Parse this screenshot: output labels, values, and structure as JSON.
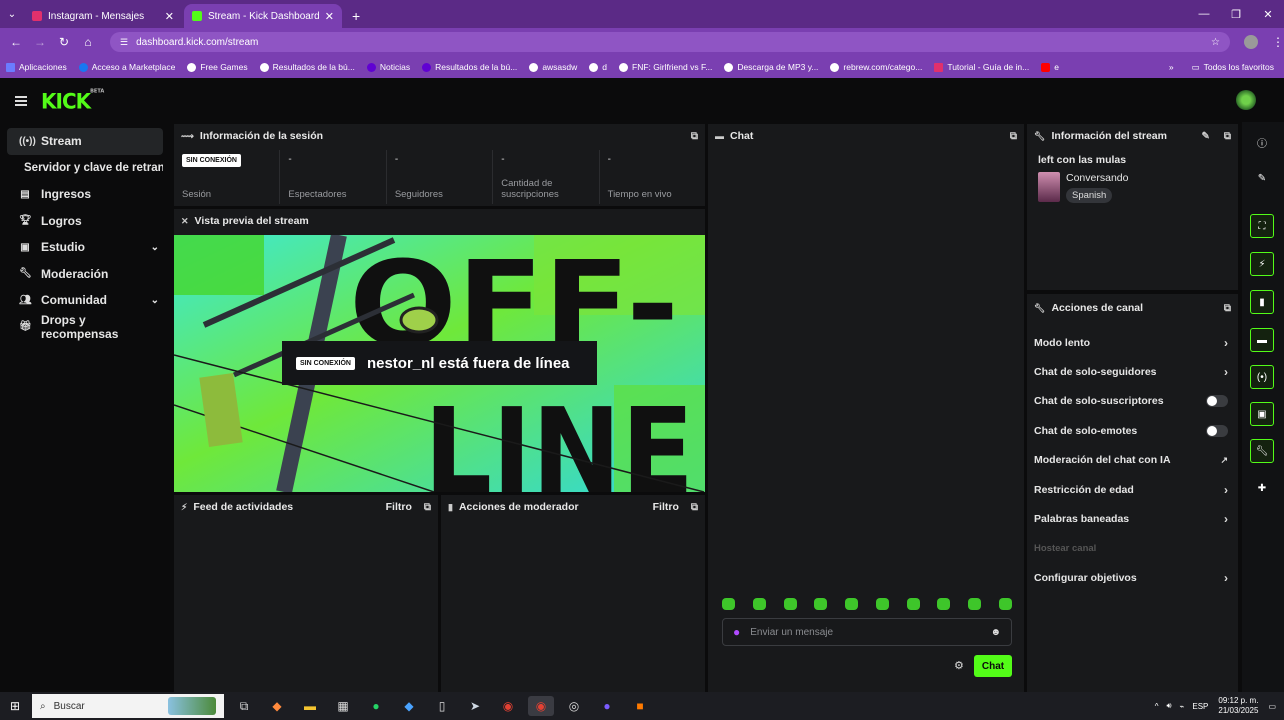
{
  "browser": {
    "tabs": [
      {
        "title": "Instagram - Mensajes",
        "active": false
      },
      {
        "title": "Stream - Kick Dashboard",
        "active": true
      }
    ],
    "url": "dashboard.kick.com/stream",
    "bookmarks": [
      "Aplicaciones",
      "Acceso a Marketplace",
      "Free Games",
      "Resultados de la bú...",
      "Noticias",
      "Resultados de la bú...",
      "awsasdw",
      "d",
      "FNF: Girlfriend vs F...",
      "Descarga de MP3 y...",
      "rebrew.com/catego...",
      "Tutorial - Guía de in...",
      "e"
    ],
    "bookmarks_right": "Todos los favoritos"
  },
  "app": {
    "logo": "KICK",
    "logo_beta": "BETA"
  },
  "sidebar": {
    "items": [
      {
        "label": "Stream",
        "icon": "broadcast-icon",
        "active": true
      },
      {
        "label": "Servidor y clave de retransm",
        "sub": true
      },
      {
        "label": "Ingresos",
        "icon": "chart-icon"
      },
      {
        "label": "Logros",
        "icon": "trophy-icon"
      },
      {
        "label": "Estudio",
        "icon": "studio-icon",
        "expand": true
      },
      {
        "label": "Moderación",
        "icon": "wrench-icon"
      },
      {
        "label": "Comunidad",
        "icon": "people-icon",
        "expand": true
      },
      {
        "label": "Drops y recompensas",
        "icon": "gift-icon"
      }
    ]
  },
  "session": {
    "title": "Información de la sesión",
    "stats": [
      {
        "value": "SIN CONEXIÓN",
        "label": "Sesión"
      },
      {
        "value": "-",
        "label": "Espectadores"
      },
      {
        "value": "-",
        "label": "Seguidores"
      },
      {
        "value": "-",
        "label": "Cantidad de suscripciones"
      },
      {
        "value": "-",
        "label": "Tiempo en vivo"
      }
    ]
  },
  "preview": {
    "title": "Vista previa del stream",
    "badge": "SIN CONEXIÓN",
    "message": "nestor_nl está fuera de línea",
    "bg_text_top": "OFF-",
    "bg_text_bottom": "LINE"
  },
  "feed": {
    "title": "Feed de actividades",
    "filter": "Filtro"
  },
  "modactions": {
    "title": "Acciones de moderador",
    "filter": "Filtro"
  },
  "chat": {
    "title": "Chat",
    "placeholder": "Enviar un mensaje",
    "send": "Chat"
  },
  "stream_info": {
    "title": "Información del stream",
    "stream_title": "left con las mulas",
    "category": "Conversando",
    "language": "Spanish"
  },
  "channel_actions": {
    "title": "Acciones de canal",
    "items": [
      {
        "label": "Modo lento",
        "control": "chevron"
      },
      {
        "label": "Chat de solo-seguidores",
        "control": "chevron"
      },
      {
        "label": "Chat de solo-suscriptores",
        "control": "toggle"
      },
      {
        "label": "Chat de solo-emotes",
        "control": "toggle"
      },
      {
        "label": "Moderación del chat con IA",
        "control": "external"
      },
      {
        "label": "Restricción de edad",
        "control": "chevron"
      },
      {
        "label": "Palabras baneadas",
        "control": "chevron"
      },
      {
        "label": "Hostear canal",
        "control": "none",
        "disabled": true
      },
      {
        "label": "Configurar objetivos",
        "control": "chevron"
      }
    ]
  },
  "taskbar": {
    "search": "Buscar",
    "lang": "ESP",
    "time": "09:12 p. m.",
    "date": "21/03/2025"
  },
  "colors": {
    "accent": "#53fc18",
    "chrome": "#7a3fb1",
    "panel": "#18191b"
  }
}
